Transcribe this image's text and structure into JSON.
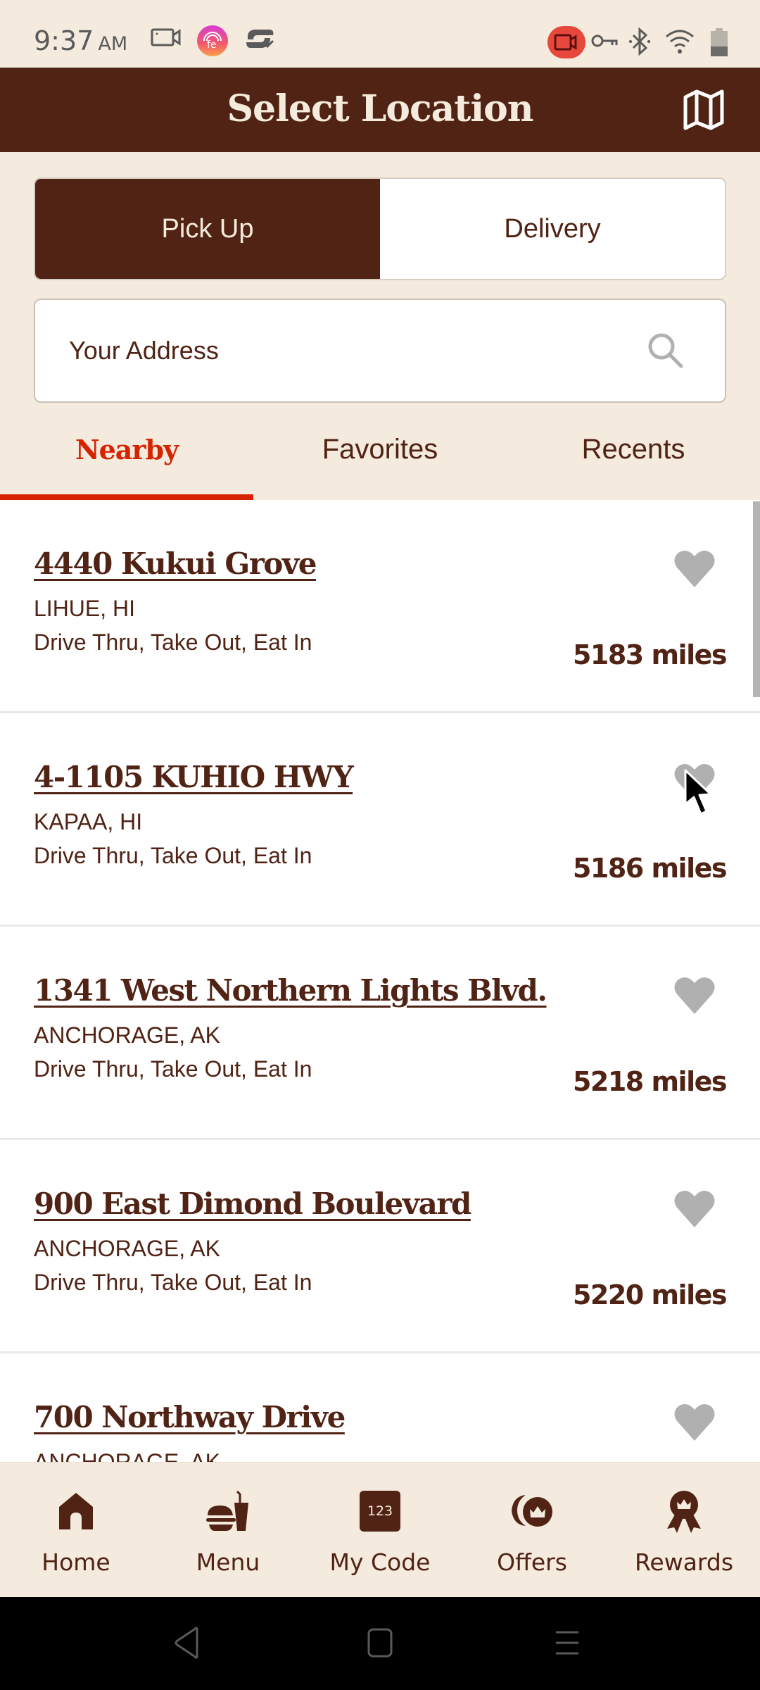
{
  "status_bar": {
    "time": "9:37",
    "ampm": "AM",
    "left_icons": [
      "screen-record-icon",
      "app-notification-icon",
      "sync-check-icon"
    ],
    "right_icons": [
      "recording-active-icon",
      "vpn-key-icon",
      "bluetooth-icon",
      "wifi-icon",
      "battery-icon"
    ]
  },
  "header": {
    "title": "Select Location",
    "map_icon": "map-icon"
  },
  "order_type": {
    "options": [
      "Pick Up",
      "Delivery"
    ],
    "selected": "Pick Up"
  },
  "address": {
    "placeholder": "Your Address",
    "value": ""
  },
  "tabs": {
    "items": [
      "Nearby",
      "Favorites",
      "Recents"
    ],
    "active": "Nearby"
  },
  "locations": [
    {
      "name": "4440 Kukui Grove",
      "city": "LIHUE, HI",
      "services": "Drive Thru, Take Out, Eat In",
      "distance": "5183 miles",
      "favorite": false
    },
    {
      "name": "4-1105 KUHIO HWY",
      "city": "KAPAA, HI",
      "services": "Drive Thru, Take Out, Eat In",
      "distance": "5186 miles",
      "favorite": false
    },
    {
      "name": "1341 West Northern Lights Blvd.",
      "city": "ANCHORAGE, AK",
      "services": "Drive Thru, Take Out, Eat In",
      "distance": "5218 miles",
      "favorite": false
    },
    {
      "name": "900 East Dimond Boulevard",
      "city": "ANCHORAGE, AK",
      "services": "Drive Thru, Take Out, Eat In",
      "distance": "5220 miles",
      "favorite": false
    },
    {
      "name": "700 Northway Drive",
      "city": "ANCHORAGE, AK",
      "services": "",
      "distance": "",
      "favorite": false
    }
  ],
  "bottom_nav": {
    "items": [
      {
        "label": "Home",
        "icon": "home-icon"
      },
      {
        "label": "Menu",
        "icon": "menu-food-icon"
      },
      {
        "label": "My Code",
        "icon": "code-icon",
        "icon_text": "123"
      },
      {
        "label": "Offers",
        "icon": "offers-icon"
      },
      {
        "label": "Rewards",
        "icon": "rewards-icon"
      }
    ]
  },
  "colors": {
    "brand_brown": "#502314",
    "accent_red": "#d62300",
    "cream": "#f4eadd",
    "heart_gray": "#b0b0b0"
  }
}
